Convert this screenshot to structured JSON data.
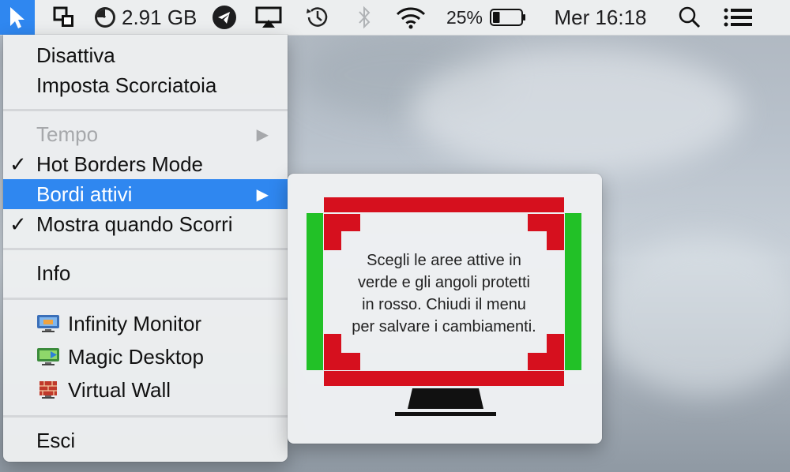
{
  "menubar": {
    "memory": "2.91 GB",
    "battery_percent": "25%",
    "battery_level": 0.25,
    "clock": "Mer 16:18",
    "icons": [
      "cursor-app-icon",
      "resize-app-icon",
      "memory-gauge-icon",
      "telegram-icon",
      "airplay-icon",
      "time-machine-icon",
      "bluetooth-icon",
      "wifi-icon",
      "battery-icon",
      "spotlight-search-icon",
      "notification-center-icon"
    ]
  },
  "menu": {
    "items": [
      {
        "label": "Disattiva"
      },
      {
        "label": "Imposta Scorciatoia"
      },
      {
        "label": "Tempo",
        "disabled": true,
        "submenu": true
      },
      {
        "label": "Hot Borders Mode",
        "checked": true
      },
      {
        "label": "Bordi attivi",
        "submenu": true,
        "selected": true
      },
      {
        "label": "Mostra quando Scorri",
        "checked": true
      },
      {
        "label": "Info"
      },
      {
        "label": "Infinity Monitor",
        "icon": "infinity-monitor-icon"
      },
      {
        "label": "Magic Desktop",
        "icon": "magic-desktop-icon"
      },
      {
        "label": "Virtual Wall",
        "icon": "virtual-wall-icon"
      },
      {
        "label": "Esci"
      }
    ],
    "checkmark": "✓",
    "submenu_arrow": "▶"
  },
  "submenu": {
    "instruction_lines": [
      "Scegli le aree attive in",
      "verde e gli angoli protetti",
      "in rosso. Chiudi il menu",
      "per salvare i cambiamenti."
    ],
    "active_color": "#22c127",
    "protected_color": "#d6101e",
    "selected_color": "#2f87f0"
  }
}
